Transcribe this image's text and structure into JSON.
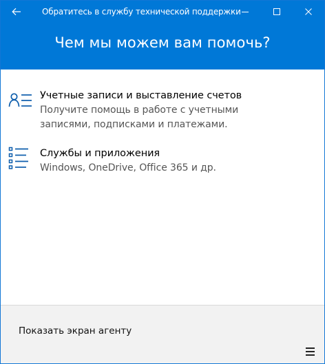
{
  "window": {
    "title": "Обратитесь в службу технической поддержки"
  },
  "header": {
    "title": "Чем мы можем вам помочь?"
  },
  "options": [
    {
      "title": "Учетные записи и выставление счетов",
      "description": "Получите помощь в работе с учетными записями, подписками и платежами.",
      "icon": "account-list-icon"
    },
    {
      "title": "Службы и приложения",
      "description": "Windows, OneDrive, Office 365 и др.",
      "icon": "bulleted-list-icon"
    }
  ],
  "footer": {
    "link_label": "Показать экран агенту",
    "menu_icon": "hamburger-menu-icon"
  },
  "colors": {
    "accent": "#0078d7",
    "footer_bg": "#f2f2f2",
    "description_text": "#555555"
  }
}
